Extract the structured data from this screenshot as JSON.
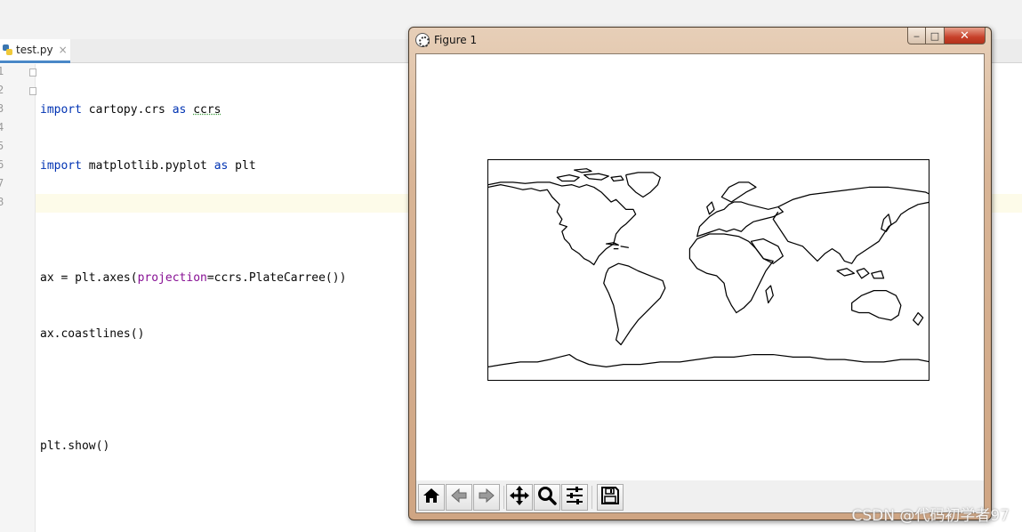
{
  "editor": {
    "tab": {
      "filename": "test.py",
      "close_glyph": "×"
    },
    "line_numbers": [
      "1",
      "2",
      "3",
      "4",
      "5",
      "6",
      "7",
      "8"
    ],
    "code": {
      "l1": {
        "kw1": "import",
        "mod": " cartopy.crs ",
        "kw2": "as",
        "alias": "ccrs"
      },
      "l2": {
        "kw1": "import",
        "mod": " matplotlib.pyplot ",
        "kw2": "as",
        "alias": " plt"
      },
      "l4": {
        "pre": "ax = plt.axes(",
        "param": "projection",
        "post": "=ccrs.PlateCarree())"
      },
      "l5": "ax.coastlines()",
      "l7": "plt.show()"
    }
  },
  "figure_window": {
    "title": "Figure 1",
    "controls": {
      "minimize": "‒",
      "maximize": "□",
      "close": "✕"
    },
    "toolbar": [
      {
        "name": "home",
        "icon": "home-icon"
      },
      {
        "name": "back",
        "icon": "back-arrow-icon"
      },
      {
        "name": "forward",
        "icon": "forward-arrow-icon"
      },
      {
        "name": "pan",
        "icon": "move-icon"
      },
      {
        "name": "zoom",
        "icon": "magnifier-icon"
      },
      {
        "name": "configure",
        "icon": "sliders-icon"
      },
      {
        "name": "save",
        "icon": "floppy-disk-icon"
      }
    ],
    "plot": {
      "type": "world coastlines map",
      "projection_shown": "PlateCarree"
    }
  },
  "watermark": "CSDN @代码初学者97"
}
